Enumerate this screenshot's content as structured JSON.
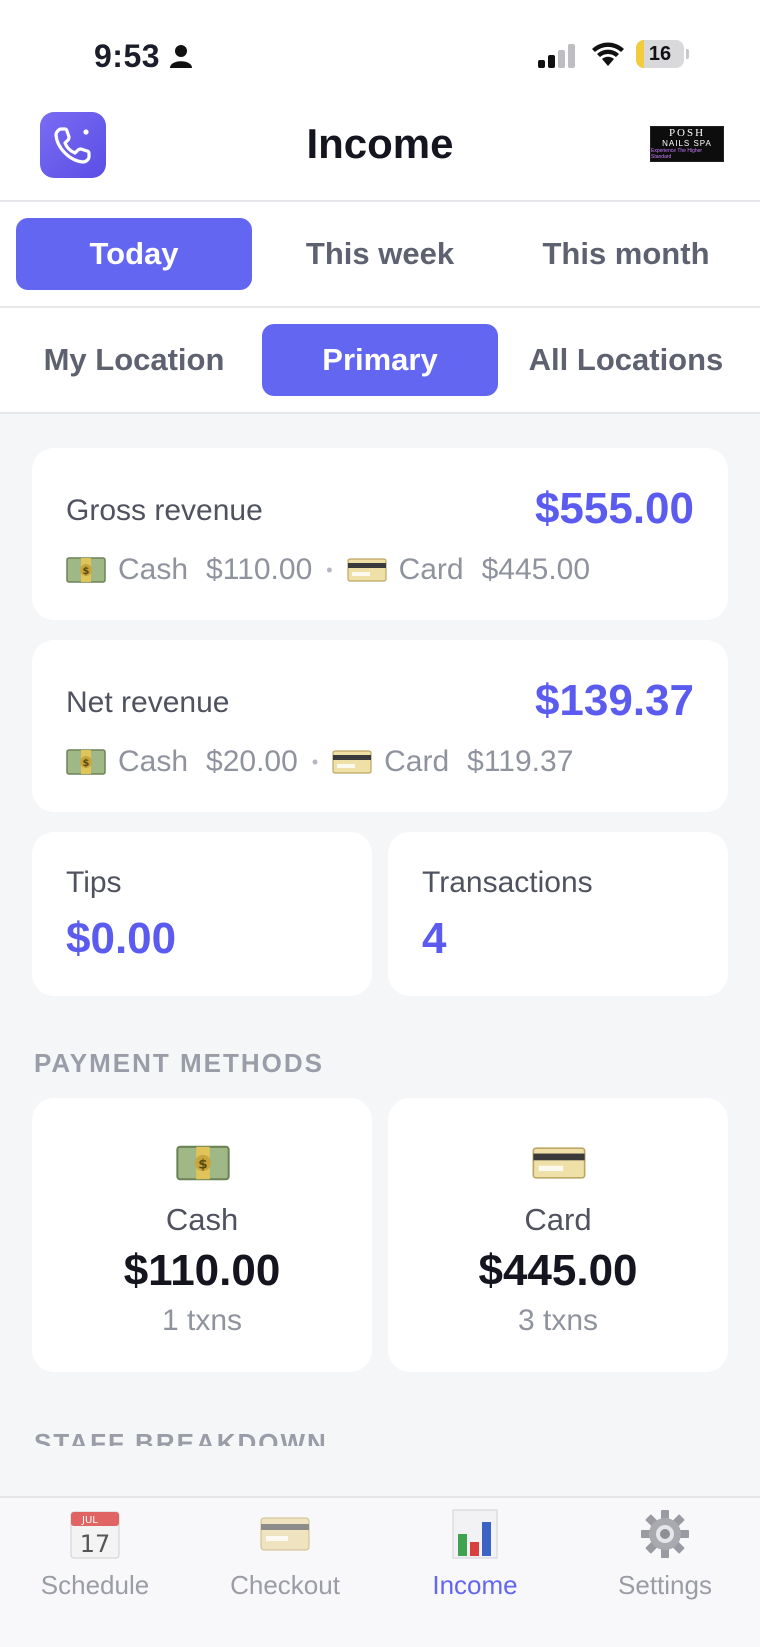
{
  "status_bar": {
    "time": "9:53",
    "battery": "16",
    "battery_level": 0.16
  },
  "header": {
    "title": "Income"
  },
  "brand": {
    "line1": "POSH",
    "line2": "NAILS SPA",
    "line3": "Experience The Higher Standard"
  },
  "period_tabs": [
    {
      "label": "Today",
      "active": true
    },
    {
      "label": "This week",
      "active": false
    },
    {
      "label": "This month",
      "active": false
    }
  ],
  "location_tabs": [
    {
      "label": "My Location",
      "active": false
    },
    {
      "label": "Primary",
      "active": true
    },
    {
      "label": "All Locations",
      "active": false
    }
  ],
  "gross": {
    "label": "Gross revenue",
    "value": "$555.00",
    "cash_label": "Cash",
    "cash_amount": "$110.00",
    "card_label": "Card",
    "card_amount": "$445.00"
  },
  "net": {
    "label": "Net revenue",
    "value": "$139.37",
    "cash_label": "Cash",
    "cash_amount": "$20.00",
    "card_label": "Card",
    "card_amount": "$119.37"
  },
  "tips": {
    "label": "Tips",
    "value": "$0.00"
  },
  "transactions": {
    "label": "Transactions",
    "value": "4"
  },
  "payment_methods": {
    "title": "PAYMENT METHODS",
    "items": [
      {
        "name": "Cash",
        "amount": "$110.00",
        "count": "1 txns",
        "icon": "money-icon"
      },
      {
        "name": "Card",
        "amount": "$445.00",
        "count": "3 txns",
        "icon": "credit-card-icon"
      }
    ]
  },
  "staff_breakdown": {
    "title": "STAFF BREAKDOWN"
  },
  "tab_bar": {
    "items": [
      {
        "label": "Schedule",
        "icon": "calendar-icon",
        "calendar_month": "JUL",
        "calendar_day": "17"
      },
      {
        "label": "Checkout",
        "icon": "credit-card-icon"
      },
      {
        "label": "Income",
        "icon": "bar-chart-icon",
        "active": true
      },
      {
        "label": "Settings",
        "icon": "gear-icon"
      }
    ]
  },
  "colors": {
    "accent": "#6366f1",
    "value_text": "#5b5cef"
  }
}
